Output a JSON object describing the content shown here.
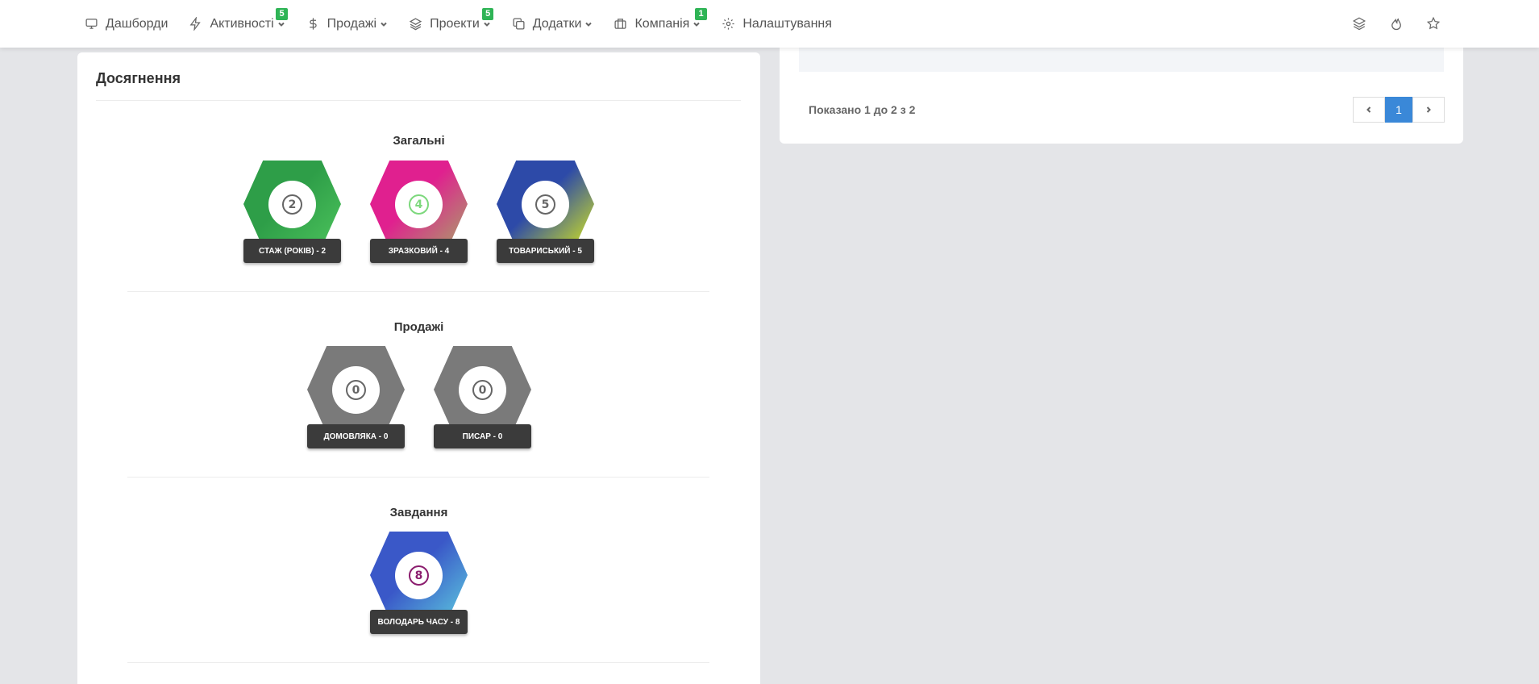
{
  "nav": {
    "items": [
      {
        "label": "Дашборди",
        "icon": "monitor-icon",
        "badge": "",
        "dropdown": false
      },
      {
        "label": "Активності",
        "icon": "lightning-icon",
        "badge": "5",
        "dropdown": true
      },
      {
        "label": "Продажі",
        "icon": "dollar-icon",
        "badge": "",
        "dropdown": true
      },
      {
        "label": "Проекти",
        "icon": "layers-icon",
        "badge": "5",
        "dropdown": true
      },
      {
        "label": "Додатки",
        "icon": "copy-icon",
        "badge": "",
        "dropdown": true
      },
      {
        "label": "Компанія",
        "icon": "briefcase-icon",
        "badge": "1",
        "dropdown": true
      },
      {
        "label": "Налаштування",
        "icon": "gear-icon",
        "badge": "",
        "dropdown": false
      }
    ],
    "right_icons": [
      "layers-icon",
      "fire-icon",
      "star-icon"
    ],
    "badge_color": "#2fb456"
  },
  "achievements": {
    "title": "Досягнення",
    "sections": [
      {
        "title": "Загальні",
        "badges": [
          {
            "value": "2",
            "label": "СТАЖ (РОКІВ) - 2",
            "colors": [
              "#2e9e48",
              "#4cc35c"
            ],
            "num_color": "#666"
          },
          {
            "value": "4",
            "label": "ЗРАЗКОВИЙ - 4",
            "colors": [
              "#e0208f",
              "#a8a268"
            ],
            "num_color": "#7dd87d"
          },
          {
            "value": "5",
            "label": "ТОВАРИСЬКИЙ - 5",
            "colors": [
              "#2d4aa8",
              "#d6e81c"
            ],
            "num_color": "#666"
          }
        ]
      },
      {
        "title": "Продажі",
        "badges": [
          {
            "value": "0",
            "label": "ДОМОВЛЯКА - 0",
            "colors": [
              "#7a7a7a",
              "#7a7a7a"
            ],
            "num_color": "#666"
          },
          {
            "value": "0",
            "label": "ПИСАР - 0",
            "colors": [
              "#7a7a7a",
              "#7a7a7a"
            ],
            "num_color": "#666"
          }
        ]
      },
      {
        "title": "Завдання",
        "badges": [
          {
            "value": "8",
            "label": "ВОЛОДАРЬ ЧАСУ - 8",
            "colors": [
              "#3a58c8",
              "#5cc8de"
            ],
            "num_color": "#8b1d6e"
          }
        ]
      }
    ]
  },
  "table": {
    "showing": "Показано 1 до 2 з 2",
    "current_page": "1"
  }
}
